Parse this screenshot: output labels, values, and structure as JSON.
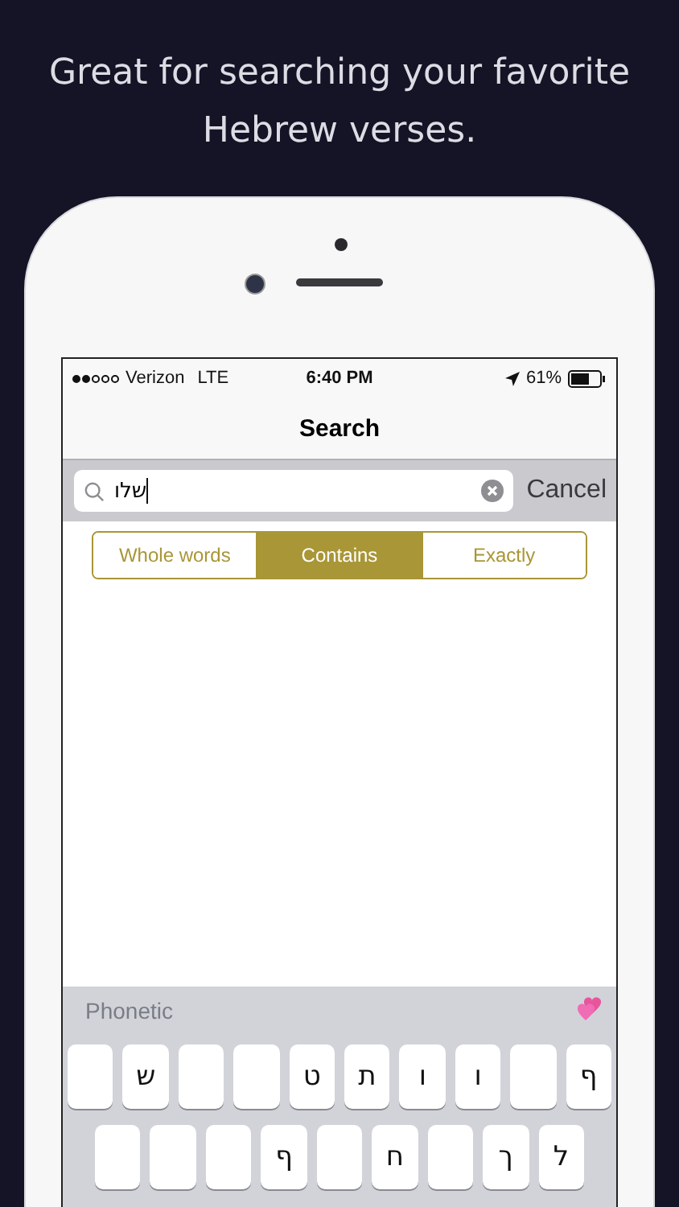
{
  "headline": [
    "Great for searching your favorite",
    "Hebrew verses."
  ],
  "status_bar": {
    "carrier": "Verizon",
    "network": "LTE",
    "time": "6:40 PM",
    "battery": "61%"
  },
  "nav": {
    "title": "Search"
  },
  "search": {
    "value": "שלו",
    "cancel": "Cancel"
  },
  "segments": [
    {
      "label": "Whole words",
      "selected": false
    },
    {
      "label": "Contains",
      "selected": true
    },
    {
      "label": "Exactly",
      "selected": false
    }
  ],
  "keyboard": {
    "mode": "Phonetic",
    "rows": [
      [
        {
          "kind": "blank"
        },
        {
          "kind": "letter",
          "label": "ש"
        },
        {
          "kind": "blank"
        },
        {
          "kind": "blank"
        },
        {
          "kind": "letter",
          "label": "ט"
        },
        {
          "kind": "letter",
          "label": "ת"
        },
        {
          "kind": "letter",
          "label": "ו"
        },
        {
          "kind": "letter",
          "label": "ו"
        },
        {
          "kind": "blank"
        },
        {
          "kind": "letter",
          "label": "ף"
        }
      ],
      [
        {
          "kind": "blank"
        },
        {
          "kind": "blank"
        },
        {
          "kind": "blank"
        },
        {
          "kind": "letter",
          "label": "ף"
        },
        {
          "kind": "blank"
        },
        {
          "kind": "letter",
          "label": "ח"
        },
        {
          "kind": "blank"
        },
        {
          "kind": "letter",
          "label": "ך"
        },
        {
          "kind": "letter",
          "label": "ל"
        }
      ]
    ]
  }
}
